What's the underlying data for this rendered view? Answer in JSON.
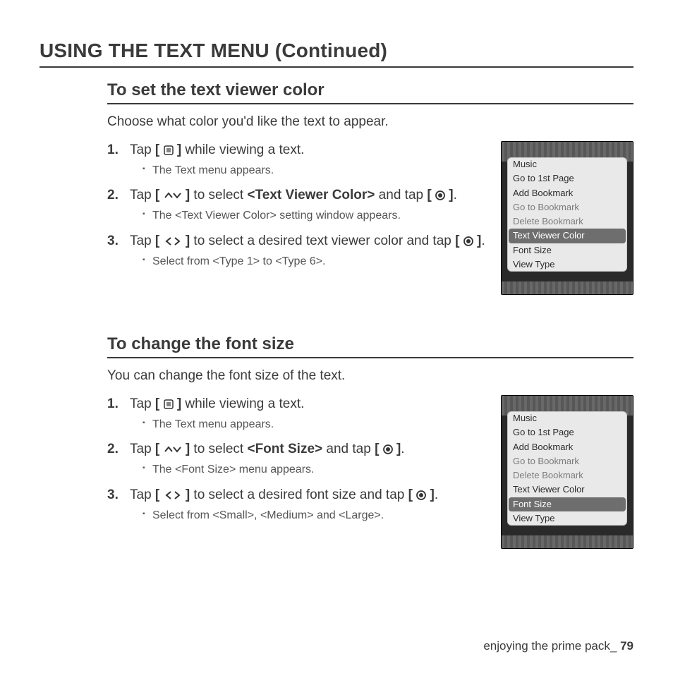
{
  "title": "USING THE TEXT MENU (Continued)",
  "footer": {
    "text": "enjoying the prime pack_ ",
    "page": "79"
  },
  "icons": {
    "menu": "menu-icon",
    "updown": "chevron-up-down-icon",
    "leftright": "chevron-left-right-icon",
    "target": "select-target-icon",
    "bl": "[",
    "br": "]"
  },
  "sections": [
    {
      "heading": "To set the text viewer color",
      "intro": "Choose what color you'd like the text to appear.",
      "steps": [
        {
          "pre": "Tap ",
          "icon1_type": "menu",
          "mid": " while viewing a text.",
          "sub": "The Text menu appears."
        },
        {
          "pre": "Tap ",
          "icon1_type": "updown",
          "mid": " to select ",
          "bold": "<Text Viewer Color>",
          "mid2": " and tap ",
          "icon2_type": "target",
          "post": ".",
          "sub": "The <Text Viewer Color> setting window appears."
        },
        {
          "pre": "Tap ",
          "icon1_type": "leftright",
          "mid": " to select a desired text viewer color and tap ",
          "icon2_type": "target",
          "post": ".",
          "sub": "Select from <Type 1> to <Type 6>."
        }
      ],
      "device_menu": [
        {
          "label": "Music",
          "state": "normal"
        },
        {
          "label": "Go to 1st Page",
          "state": "normal"
        },
        {
          "label": "Add Bookmark",
          "state": "normal"
        },
        {
          "label": "Go to Bookmark",
          "state": "dim"
        },
        {
          "label": "Delete Bookmark",
          "state": "dim"
        },
        {
          "label": "Text Viewer Color",
          "state": "sel"
        },
        {
          "label": "Font Size",
          "state": "normal"
        },
        {
          "label": "View Type",
          "state": "normal"
        }
      ]
    },
    {
      "heading": "To change the font size",
      "intro": "You can change the font size of the text.",
      "steps": [
        {
          "pre": "Tap ",
          "icon1_type": "menu",
          "mid": " while viewing a text.",
          "sub": "The Text menu appears."
        },
        {
          "pre": "Tap ",
          "icon1_type": "updown",
          "mid": " to select ",
          "bold": "<Font Size>",
          "mid2": " and tap ",
          "icon2_type": "target",
          "post": ".",
          "sub": "The <Font Size> menu appears."
        },
        {
          "pre": "Tap ",
          "icon1_type": "leftright",
          "mid": " to select a desired font size and tap ",
          "icon2_type": "target",
          "post": ".",
          "sub": "Select from <Small>, <Medium> and <Large>."
        }
      ],
      "device_menu": [
        {
          "label": "Music",
          "state": "normal"
        },
        {
          "label": "Go to 1st Page",
          "state": "normal"
        },
        {
          "label": "Add Bookmark",
          "state": "normal"
        },
        {
          "label": "Go to Bookmark",
          "state": "dim"
        },
        {
          "label": "Delete Bookmark",
          "state": "dim"
        },
        {
          "label": "Text Viewer Color",
          "state": "normal"
        },
        {
          "label": "Font Size",
          "state": "sel"
        },
        {
          "label": "View Type",
          "state": "normal"
        }
      ]
    }
  ]
}
